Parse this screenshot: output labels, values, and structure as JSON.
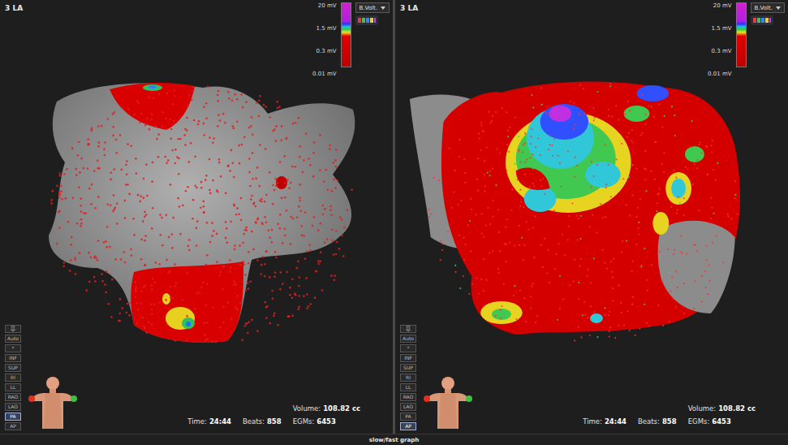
{
  "panels": [
    {
      "title": "3 LA",
      "map_kind": "posterior",
      "scale_labels": [
        "20 mV",
        "1.5 mV",
        "0.3 mV",
        "0.01 mV"
      ],
      "map_mode": "B.Volt.",
      "quick_buttons": [
        "Auto",
        "*"
      ],
      "view_buttons": [
        {
          "label": "INF",
          "selected": false
        },
        {
          "label": "SUP",
          "selected": false
        },
        {
          "label": "RI",
          "selected": false
        },
        {
          "label": "LL",
          "selected": false
        },
        {
          "label": "RAO",
          "selected": false
        },
        {
          "label": "LAO",
          "selected": false
        },
        {
          "label": "PA",
          "selected": true
        },
        {
          "label": "AP",
          "selected": false
        }
      ],
      "stats": [
        {
          "label": "Volume:",
          "value": "108.82 cc"
        },
        {
          "label": "Time:",
          "value": "24:44"
        },
        {
          "label": "Beats:",
          "value": "858"
        },
        {
          "label": "EGMs:",
          "value": "6453"
        }
      ]
    },
    {
      "title": "3 LA",
      "map_kind": "anterior",
      "scale_labels": [
        "20 mV",
        "1.5 mV",
        "0.3 mV",
        "0.01 mV"
      ],
      "map_mode": "B.Volt.",
      "quick_buttons": [
        "Auto",
        "*"
      ],
      "view_buttons": [
        {
          "label": "INF",
          "selected": false
        },
        {
          "label": "SUP",
          "selected": false
        },
        {
          "label": "RI",
          "selected": false
        },
        {
          "label": "LL",
          "selected": false
        },
        {
          "label": "RAO",
          "selected": false
        },
        {
          "label": "LAO",
          "selected": false
        },
        {
          "label": "PA",
          "selected": false
        },
        {
          "label": "AP",
          "selected": true
        }
      ],
      "stats": [
        {
          "label": "Volume:",
          "value": "108.82 cc"
        },
        {
          "label": "Time:",
          "value": "24:44"
        },
        {
          "label": "Beats:",
          "value": "858"
        },
        {
          "label": "EGMs:",
          "value": "6453"
        }
      ]
    }
  ],
  "status_bar": {
    "label": "slow/fast graph"
  }
}
